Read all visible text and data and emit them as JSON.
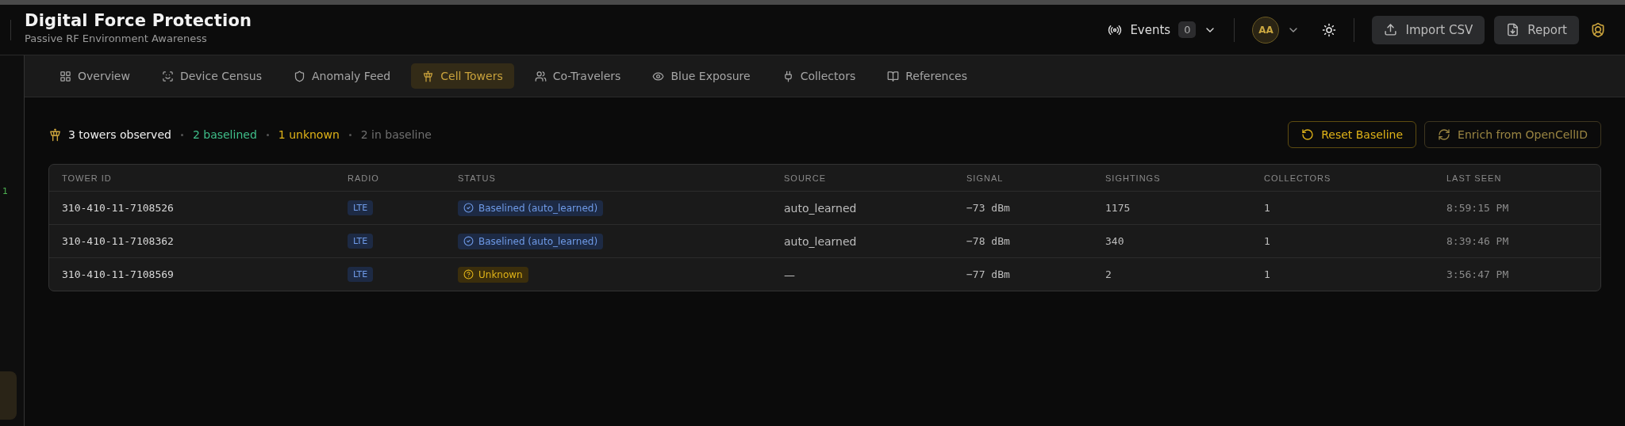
{
  "rail": {
    "marker": "1"
  },
  "header": {
    "title": "Digital Force Protection",
    "subtitle": "Passive RF Environment Awareness",
    "events": {
      "label": "Events",
      "count": "0"
    },
    "avatar": {
      "initials": "AA"
    },
    "buttons": [
      {
        "label": "Import CSV",
        "kind": "import"
      },
      {
        "label": "Report",
        "kind": "report"
      }
    ]
  },
  "tabs": [
    {
      "label": "Overview",
      "selected": false
    },
    {
      "label": "Device Census",
      "selected": false
    },
    {
      "label": "Anomaly Feed",
      "selected": false
    },
    {
      "label": "Cell Towers",
      "selected": true
    },
    {
      "label": "Co-Travelers",
      "selected": false
    },
    {
      "label": "Blue Exposure",
      "selected": false
    },
    {
      "label": "Collectors",
      "selected": false
    },
    {
      "label": "References",
      "selected": false
    }
  ],
  "summary": [
    {
      "text": "3 towers observed",
      "kind": "total"
    },
    {
      "text": "2 baselined",
      "kind": "baselined"
    },
    {
      "text": "1 unknown",
      "kind": "unknown"
    },
    {
      "text": "2 in baseline",
      "kind": "muted"
    }
  ],
  "actions": [
    {
      "label": "Reset Baseline",
      "kind": "reset"
    },
    {
      "label": "Enrich from OpenCellID",
      "kind": "enrich"
    }
  ],
  "table": {
    "columns": [
      "TOWER ID",
      "RADIO",
      "STATUS",
      "SOURCE",
      "SIGNAL",
      "SIGHTINGS",
      "COLLECTORS",
      "LAST SEEN"
    ],
    "rows": [
      {
        "tower_id": "310-410-11-7108526",
        "radio": "LTE",
        "status": {
          "label": "Baselined (auto_learned)",
          "kind": "baselined"
        },
        "source": "auto_learned",
        "signal": "−73 dBm",
        "sightings": "1175",
        "collectors": "1",
        "last_seen": "8:59:15 PM"
      },
      {
        "tower_id": "310-410-11-7108362",
        "radio": "LTE",
        "status": {
          "label": "Baselined (auto_learned)",
          "kind": "baselined"
        },
        "source": "auto_learned",
        "signal": "−78 dBm",
        "sightings": "340",
        "collectors": "1",
        "last_seen": "8:39:46 PM"
      },
      {
        "tower_id": "310-410-11-7108569",
        "radio": "LTE",
        "status": {
          "label": "Unknown",
          "kind": "unknown"
        },
        "source": "—",
        "signal": "−77 dBm",
        "sightings": "2",
        "collectors": "1",
        "last_seen": "3:56:47 PM"
      }
    ]
  }
}
